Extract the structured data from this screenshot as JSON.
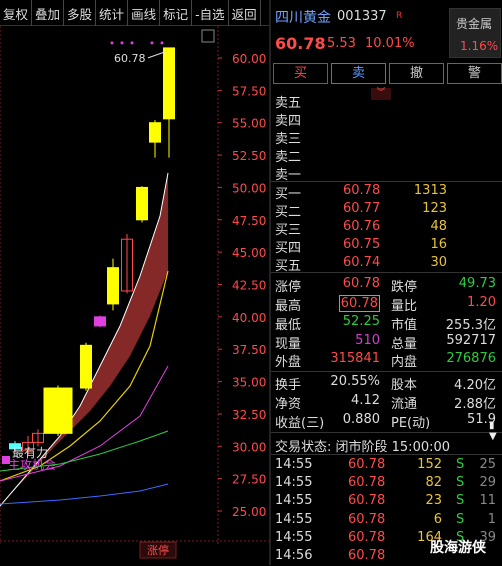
{
  "toolbar": [
    "复权",
    "叠加",
    "多股",
    "统计",
    "画线",
    "标记",
    "-自选",
    "返回"
  ],
  "chart": {
    "high_label": "60.78",
    "price_axis": [
      "60.00",
      "57.50",
      "55.00",
      "52.50",
      "50.00",
      "47.50",
      "45.00",
      "42.50",
      "40.00",
      "37.50",
      "35.00",
      "32.50",
      "30.00",
      "27.50",
      "25.00"
    ],
    "limit_label": "涨停",
    "annot_strong": "最有力",
    "annot_buy": "主攻机会",
    "colors": {
      "up": "#ffff00",
      "band": "#8b2a2a",
      "axis_text": "#ff4a4a"
    }
  },
  "header": {
    "name": "四川黄金",
    "code": "001337",
    "r_tag": "R",
    "sector_name": "贵金属",
    "sector_pct": "1.16%",
    "price": "60.78",
    "change": "5.53",
    "change_pct": "10.01%"
  },
  "buttons": {
    "buy": "买",
    "sell": "卖",
    "cancel": "撤",
    "alert": "警"
  },
  "asks": [
    {
      "label": "卖五",
      "price": "",
      "vol": ""
    },
    {
      "label": "卖四",
      "price": "",
      "vol": ""
    },
    {
      "label": "卖三",
      "price": "",
      "vol": ""
    },
    {
      "label": "卖二",
      "price": "",
      "vol": ""
    },
    {
      "label": "卖一",
      "price": "",
      "vol": ""
    }
  ],
  "bids": [
    {
      "label": "买一",
      "price": "60.78",
      "vol": "1313"
    },
    {
      "label": "买二",
      "price": "60.77",
      "vol": "123"
    },
    {
      "label": "买三",
      "price": "60.76",
      "vol": "48"
    },
    {
      "label": "买四",
      "price": "60.75",
      "vol": "16"
    },
    {
      "label": "买五",
      "price": "60.74",
      "vol": "30"
    }
  ],
  "quote": {
    "limit_up_k": "涨停",
    "limit_up": "60.78",
    "limit_down_k": "跌停",
    "limit_down": "49.73",
    "high_k": "最高",
    "high": "60.78",
    "vol_ratio_k": "量比",
    "vol_ratio": "1.20",
    "low_k": "最低",
    "low": "52.25",
    "mcap_k": "市值",
    "mcap": "255.3亿",
    "cur_k": "现量",
    "cur": "510",
    "total_k": "总量",
    "total": "592717",
    "outer_k": "外盘",
    "outer": "315841",
    "inner_k": "内盘",
    "inner": "276876",
    "turnover_k": "换手",
    "turnover": "20.55%",
    "share_k": "股本",
    "share": "4.20亿",
    "nav_k": "净资",
    "nav": "4.12",
    "float_k": "流通",
    "float": "2.88亿",
    "eps_k": "收益(三)",
    "eps": "0.880",
    "pe_k": "PE(动)",
    "pe": "51.9"
  },
  "status": "交易状态: 闭市阶段 15:00:00",
  "ticks": [
    {
      "t": "14:55",
      "p": "60.78",
      "v": "152",
      "s": "S",
      "n": "25"
    },
    {
      "t": "14:55",
      "p": "60.78",
      "v": "82",
      "s": "S",
      "n": "29"
    },
    {
      "t": "14:55",
      "p": "60.78",
      "v": "23",
      "s": "S",
      "n": "11"
    },
    {
      "t": "14:55",
      "p": "60.78",
      "v": "6",
      "s": "S",
      "n": "1"
    },
    {
      "t": "14:55",
      "p": "60.78",
      "v": "164",
      "s": "S",
      "n": "39"
    },
    {
      "t": "14:56",
      "p": "60.78",
      "v": "",
      "s": "",
      "n": ""
    }
  ],
  "watermark": "股海游侠"
}
